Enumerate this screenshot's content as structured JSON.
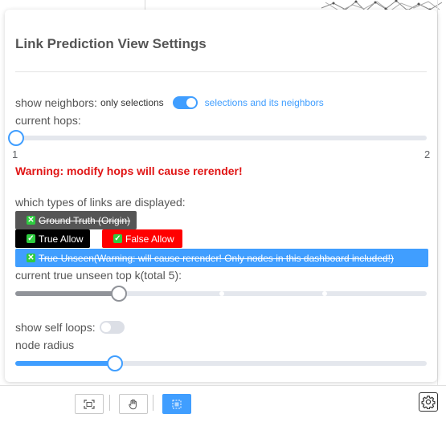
{
  "panel": {
    "title": "Link Prediction View Settings",
    "show_neighbors": {
      "label": "show neighbors:",
      "off_text": "only selections",
      "on_text": "selections and its neighbors",
      "enabled": true
    },
    "hops": {
      "label": "current hops:",
      "min": "1",
      "max": "2",
      "value": 1
    },
    "hops_warning": "Warning: modify hops will cause rerender!",
    "link_types": {
      "label": "which types of links are displayed:",
      "items": [
        {
          "label": "Ground Truth (Origin)",
          "checked": false,
          "color": "#555555"
        },
        {
          "label": "True Allow",
          "checked": true,
          "color": "#000000"
        },
        {
          "label": "False Allow",
          "checked": true,
          "color": "#ff0000"
        },
        {
          "label": "True Unseen(Warning: will cause rerender! Only nodes in this dashboard included!)",
          "checked": false,
          "color": "#409eff"
        }
      ]
    },
    "top_k": {
      "label": "current true unseen top k(total 5):",
      "value": 2,
      "total": 5
    },
    "self_loops": {
      "label": "show self loops:",
      "enabled": false
    },
    "node_radius": {
      "label": "node radius",
      "value_fraction": 0.24
    }
  },
  "toolbar": {
    "buttons": [
      {
        "icon": "fit-view-icon",
        "active": false
      },
      {
        "icon": "hand-pan-icon",
        "active": false
      },
      {
        "icon": "box-select-icon",
        "active": true
      }
    ],
    "settings_icon": "gear-icon"
  },
  "colors": {
    "accent": "#409eff",
    "warning": "#e01515"
  }
}
